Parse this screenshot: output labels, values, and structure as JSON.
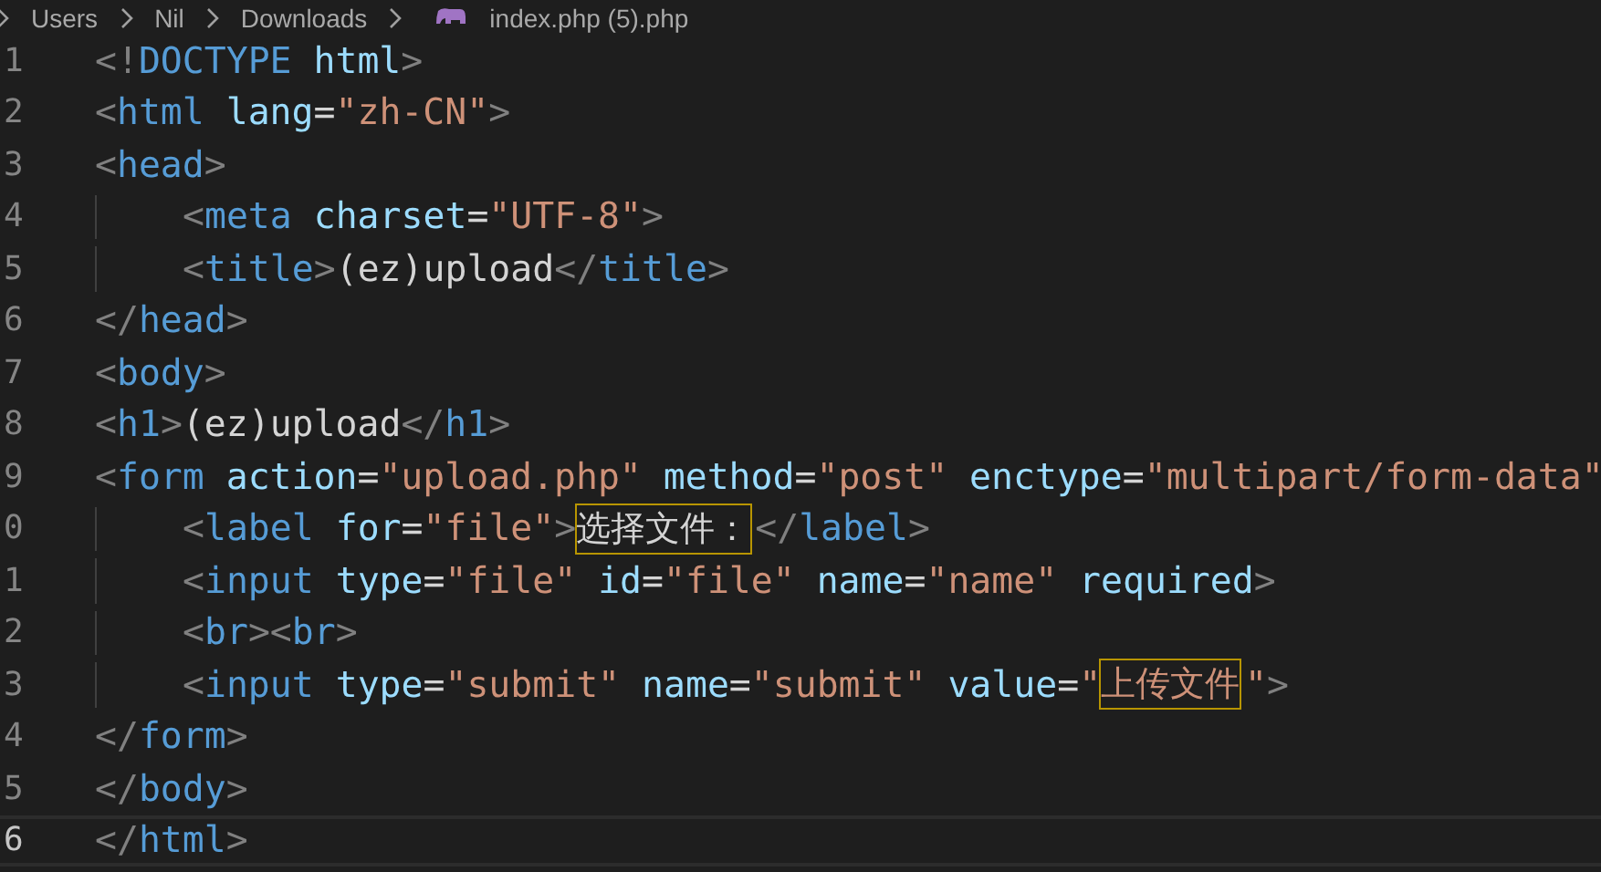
{
  "breadcrumb": {
    "folders": [
      "Users",
      "Nil",
      "Downloads"
    ],
    "file": "index.php (5).php"
  },
  "lines": [
    {
      "number": "1",
      "current": false,
      "tokens": [
        {
          "kind": "punct",
          "text": "<!"
        },
        {
          "kind": "tag",
          "text": "DOCTYPE"
        },
        {
          "kind": "attr",
          "text": "html"
        },
        {
          "kind": "punct",
          "text": ">"
        }
      ]
    },
    {
      "number": "2",
      "current": false,
      "tokens": [
        {
          "kind": "punct",
          "text": "<"
        },
        {
          "kind": "tag",
          "text": "html"
        },
        {
          "kind": "attr",
          "text": "lang"
        },
        {
          "kind": "plain",
          "text": "="
        },
        {
          "kind": "string",
          "text": "\"zh-CN\""
        },
        {
          "kind": "punct",
          "text": ">"
        }
      ]
    },
    {
      "number": "3",
      "current": false,
      "tokens": [
        {
          "kind": "punct",
          "text": "<"
        },
        {
          "kind": "tag",
          "text": "head"
        },
        {
          "kind": "punct",
          "text": ">"
        }
      ],
      "children": [
        {
          "number": "4",
          "current": false,
          "tokens": [
            {
              "kind": "punct",
              "text": "<"
            },
            {
              "kind": "tag",
              "text": "meta"
            },
            {
              "kind": "attr",
              "text": "charset"
            },
            {
              "kind": "plain",
              "text": "="
            },
            {
              "kind": "string",
              "text": "\"UTF-8\""
            },
            {
              "kind": "punct",
              "text": ">"
            }
          ]
        },
        {
          "number": "5",
          "current": false,
          "tokens": [
            {
              "kind": "punct",
              "text": "<"
            },
            {
              "kind": "tag",
              "text": "title"
            },
            {
              "kind": "punct",
              "text": ">"
            },
            {
              "kind": "plain",
              "text": "(ez)upload"
            },
            {
              "kind": "punct",
              "text": "</"
            },
            {
              "kind": "tag",
              "text": "title"
            },
            {
              "kind": "punct",
              "text": ">"
            }
          ]
        }
      ]
    },
    {
      "number": "6",
      "current": false,
      "tokens": [
        {
          "kind": "punct",
          "text": "</"
        },
        {
          "kind": "tag",
          "text": "head"
        },
        {
          "kind": "punct",
          "text": ">"
        }
      ]
    },
    {
      "number": "7",
      "current": false,
      "tokens": [
        {
          "kind": "punct",
          "text": "<"
        },
        {
          "kind": "tag",
          "text": "body"
        },
        {
          "kind": "punct",
          "text": ">"
        }
      ]
    },
    {
      "number": "8",
      "current": false,
      "tokens": [
        {
          "kind": "punct",
          "text": "<"
        },
        {
          "kind": "tag",
          "text": "h1"
        },
        {
          "kind": "punct",
          "text": ">"
        },
        {
          "kind": "plain",
          "text": "(ez)upload"
        },
        {
          "kind": "punct",
          "text": "</"
        },
        {
          "kind": "tag",
          "text": "h1"
        },
        {
          "kind": "punct",
          "text": ">"
        }
      ]
    },
    {
      "number": "9",
      "current": false,
      "tokens": [
        {
          "kind": "punct",
          "text": "<"
        },
        {
          "kind": "tag",
          "text": "form"
        },
        {
          "kind": "attr",
          "text": "action"
        },
        {
          "kind": "plain",
          "text": "="
        },
        {
          "kind": "string",
          "text": "\"upload.php\""
        },
        {
          "kind": "attr",
          "text": "method"
        },
        {
          "kind": "plain",
          "text": "="
        },
        {
          "kind": "string",
          "text": "\"post\""
        },
        {
          "kind": "attr",
          "text": "enctype"
        },
        {
          "kind": "plain",
          "text": "="
        },
        {
          "kind": "string",
          "text": "\"multipart/form-data\""
        }
      ],
      "children": [
        {
          "number": "0",
          "current": false,
          "tokens": [
            {
              "kind": "punct",
              "text": "<"
            },
            {
              "kind": "tag",
              "text": "label"
            },
            {
              "kind": "attr",
              "text": "for"
            },
            {
              "kind": "plain",
              "text": "="
            },
            {
              "kind": "string",
              "text": "\"file\""
            },
            {
              "kind": "punct",
              "text": ">"
            },
            {
              "kind": "plain",
              "text": "选择文件：",
              "boxed": true
            },
            {
              "kind": "punct",
              "text": "</"
            },
            {
              "kind": "tag",
              "text": "label"
            },
            {
              "kind": "punct",
              "text": ">"
            }
          ]
        },
        {
          "number": "1",
          "current": false,
          "tokens": [
            {
              "kind": "punct",
              "text": "<"
            },
            {
              "kind": "tag",
              "text": "input"
            },
            {
              "kind": "attr",
              "text": "type"
            },
            {
              "kind": "plain",
              "text": "="
            },
            {
              "kind": "string",
              "text": "\"file\""
            },
            {
              "kind": "attr",
              "text": "id"
            },
            {
              "kind": "plain",
              "text": "="
            },
            {
              "kind": "string",
              "text": "\"file\""
            },
            {
              "kind": "attr",
              "text": "name"
            },
            {
              "kind": "plain",
              "text": "="
            },
            {
              "kind": "string",
              "text": "\"name\""
            },
            {
              "kind": "attr",
              "text": "required"
            },
            {
              "kind": "punct",
              "text": ">"
            }
          ]
        },
        {
          "number": "2",
          "current": false,
          "tokens": [
            {
              "kind": "punct",
              "text": "<"
            },
            {
              "kind": "tag",
              "text": "br"
            },
            {
              "kind": "punct",
              "text": "><"
            },
            {
              "kind": "tag",
              "text": "br"
            },
            {
              "kind": "punct",
              "text": ">"
            }
          ]
        },
        {
          "number": "3",
          "current": false,
          "tokens": [
            {
              "kind": "punct",
              "text": "<"
            },
            {
              "kind": "tag",
              "text": "input"
            },
            {
              "kind": "attr",
              "text": "type"
            },
            {
              "kind": "plain",
              "text": "="
            },
            {
              "kind": "string",
              "text": "\"submit\""
            },
            {
              "kind": "attr",
              "text": "name"
            },
            {
              "kind": "plain",
              "text": "="
            },
            {
              "kind": "string",
              "text": "\"submit\""
            },
            {
              "kind": "attr",
              "text": "value"
            },
            {
              "kind": "plain",
              "text": "="
            },
            {
              "kind": "string",
              "text": "\""
            },
            {
              "kind": "string",
              "text": "上传文件",
              "boxed": true
            },
            {
              "kind": "string",
              "text": "\""
            },
            {
              "kind": "punct",
              "text": ">"
            }
          ]
        }
      ]
    },
    {
      "number": "4",
      "current": false,
      "tokens": [
        {
          "kind": "punct",
          "text": "</"
        },
        {
          "kind": "tag",
          "text": "form"
        },
        {
          "kind": "punct",
          "text": ">"
        }
      ]
    },
    {
      "number": "5",
      "current": false,
      "tokens": [
        {
          "kind": "punct",
          "text": "</"
        },
        {
          "kind": "tag",
          "text": "body"
        },
        {
          "kind": "punct",
          "text": ">"
        }
      ]
    },
    {
      "number": "6",
      "current": true,
      "tokens": [
        {
          "kind": "punct",
          "text": "</"
        },
        {
          "kind": "tag",
          "text": "html"
        },
        {
          "kind": "punct",
          "text": ">"
        }
      ]
    }
  ]
}
